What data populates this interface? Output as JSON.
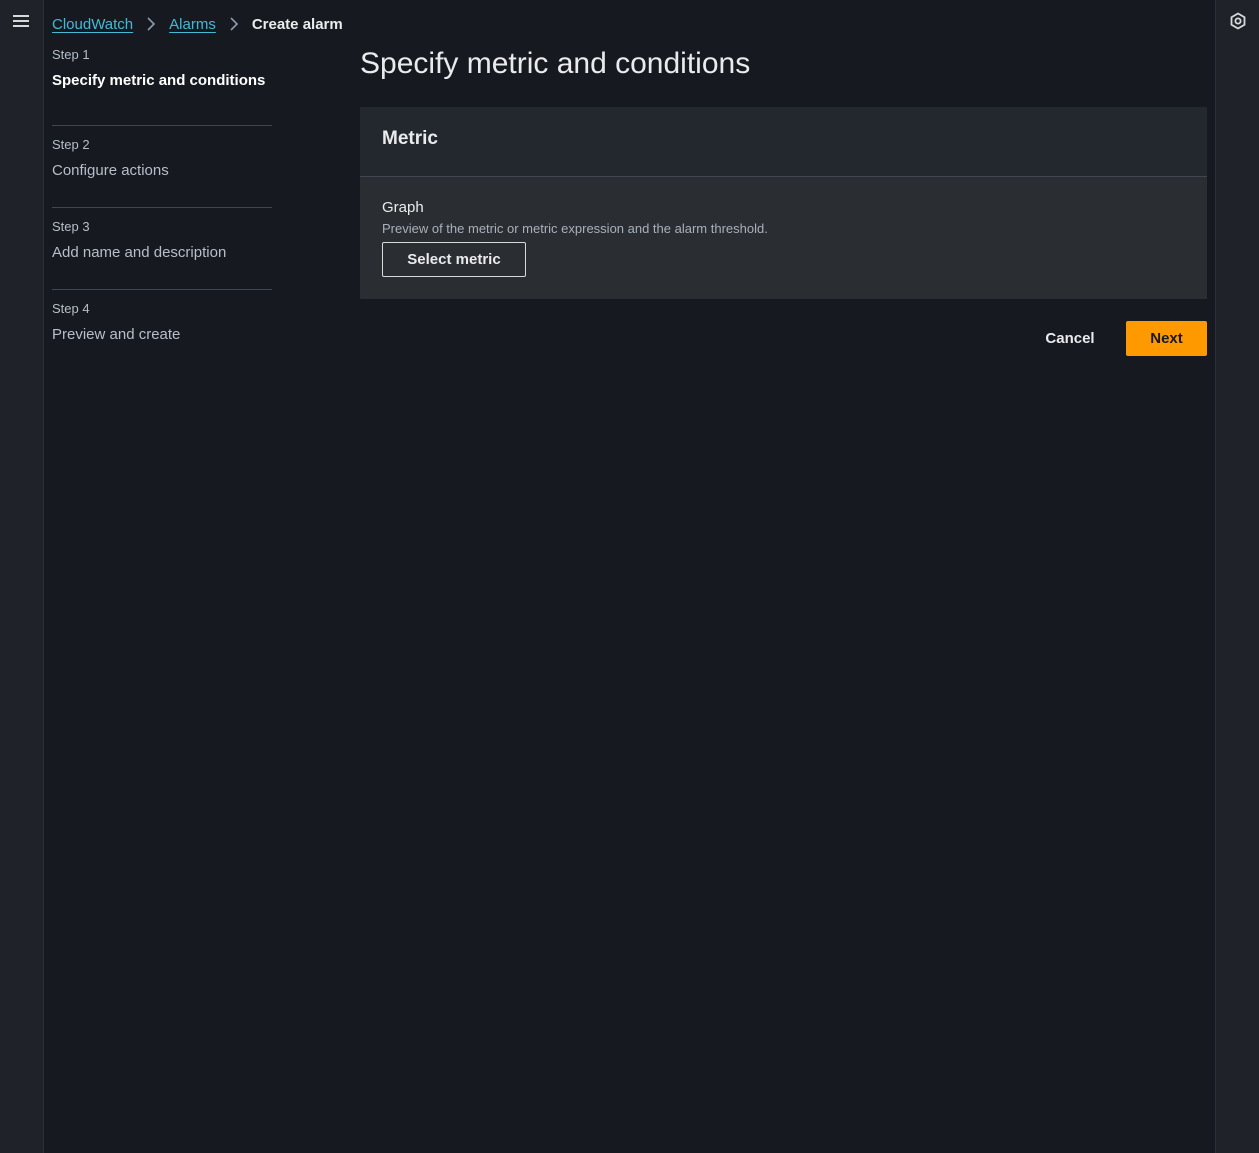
{
  "breadcrumb": {
    "items": [
      {
        "label": "CloudWatch"
      },
      {
        "label": "Alarms"
      }
    ],
    "current": "Create alarm"
  },
  "steps": [
    {
      "number": "Step 1",
      "title": "Specify metric and conditions",
      "active": true
    },
    {
      "number": "Step 2",
      "title": "Configure actions",
      "active": false
    },
    {
      "number": "Step 3",
      "title": "Add name and description",
      "active": false
    },
    {
      "number": "Step 4",
      "title": "Preview and create",
      "active": false
    }
  ],
  "main": {
    "title": "Specify metric and conditions",
    "panel": {
      "header": "Metric",
      "graph_label": "Graph",
      "graph_description": "Preview of the metric or metric expression and the alarm threshold.",
      "select_metric_label": "Select metric"
    }
  },
  "footer": {
    "cancel_label": "Cancel",
    "next_label": "Next"
  },
  "icons": {
    "menu": "hamburger-menu-icon",
    "help": "help-settings-icon",
    "breadcrumb_separator": "chevron-right-icon"
  },
  "colors": {
    "background": "#161a20",
    "link": "#44b9d6",
    "primary_button": "#ff9900",
    "panel": "#2a2e33"
  }
}
